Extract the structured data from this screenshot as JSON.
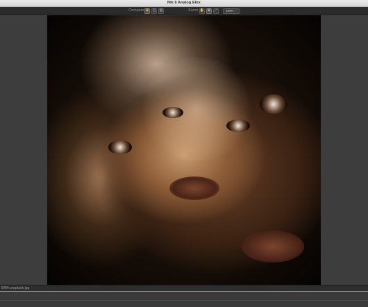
{
  "window": {
    "title": "Nik 6 Analog Efex"
  },
  "toolbar": {
    "compare_label": "Compare",
    "zoom_label": "Zoom",
    "compare_buttons": [
      {
        "icon": "single-view-icon",
        "glyph": "▣"
      },
      {
        "icon": "split-view-icon",
        "glyph": "◫"
      },
      {
        "icon": "side-by-side-icon",
        "glyph": "▥"
      }
    ],
    "zoom_buttons": [
      {
        "icon": "hand-tool-icon",
        "glyph": "✋"
      },
      {
        "icon": "zoom-loupe-icon",
        "glyph": "◉"
      },
      {
        "icon": "fit-screen-icon",
        "glyph": "⤢"
      }
    ],
    "zoom_value": "100%",
    "zoom_chevron": "⌃"
  },
  "status": {
    "filename": "BRN-unsplash.jpg"
  },
  "colors": {
    "accent": "#d48b1a",
    "compare_active": "#f0a424"
  }
}
